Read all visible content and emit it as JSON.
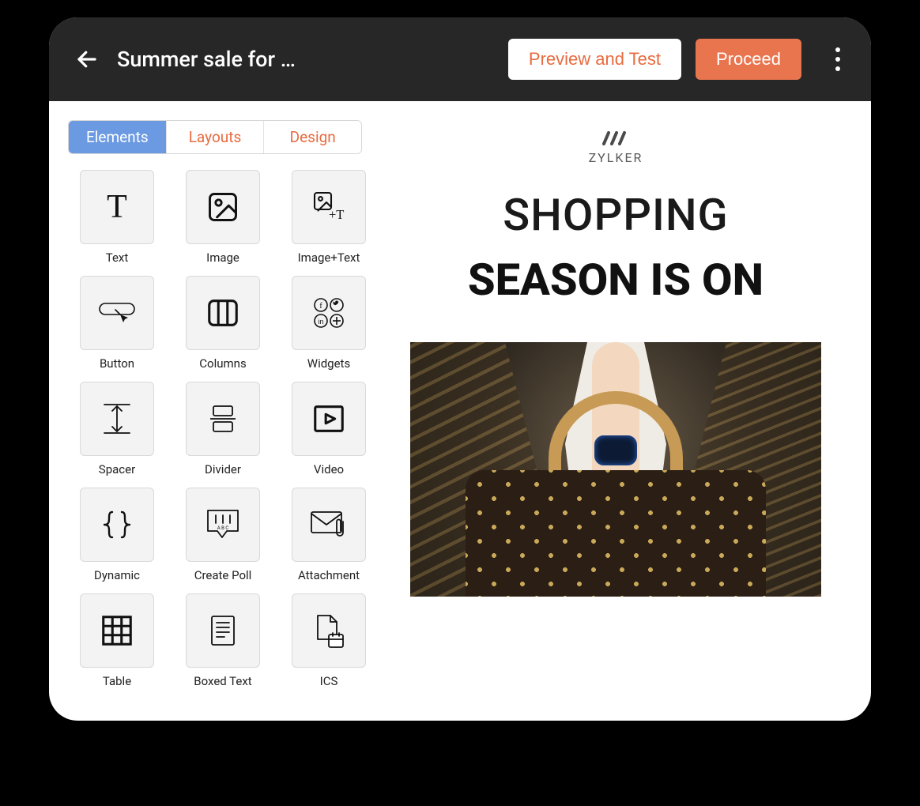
{
  "header": {
    "title": "Summer sale for …",
    "preview_label": "Preview and Test",
    "proceed_label": "Proceed"
  },
  "tabs": {
    "elements": "Elements",
    "layouts": "Layouts",
    "design": "Design"
  },
  "elements": [
    {
      "id": "text",
      "label": "Text"
    },
    {
      "id": "image",
      "label": "Image"
    },
    {
      "id": "image-text",
      "label": "Image+Text"
    },
    {
      "id": "button",
      "label": "Button"
    },
    {
      "id": "columns",
      "label": "Columns"
    },
    {
      "id": "widgets",
      "label": "Widgets"
    },
    {
      "id": "spacer",
      "label": "Spacer"
    },
    {
      "id": "divider",
      "label": "Divider"
    },
    {
      "id": "video",
      "label": "Video"
    },
    {
      "id": "dynamic",
      "label": "Dynamic"
    },
    {
      "id": "create-poll",
      "label": "Create Poll"
    },
    {
      "id": "attachment",
      "label": "Attachment"
    },
    {
      "id": "table",
      "label": "Table"
    },
    {
      "id": "boxed-text",
      "label": "Boxed Text"
    },
    {
      "id": "ics",
      "label": "ICS"
    }
  ],
  "canvas": {
    "brand": "ZYLKER",
    "headline_line1": "SHOPPING",
    "headline_line2": "SEASON IS ON"
  }
}
